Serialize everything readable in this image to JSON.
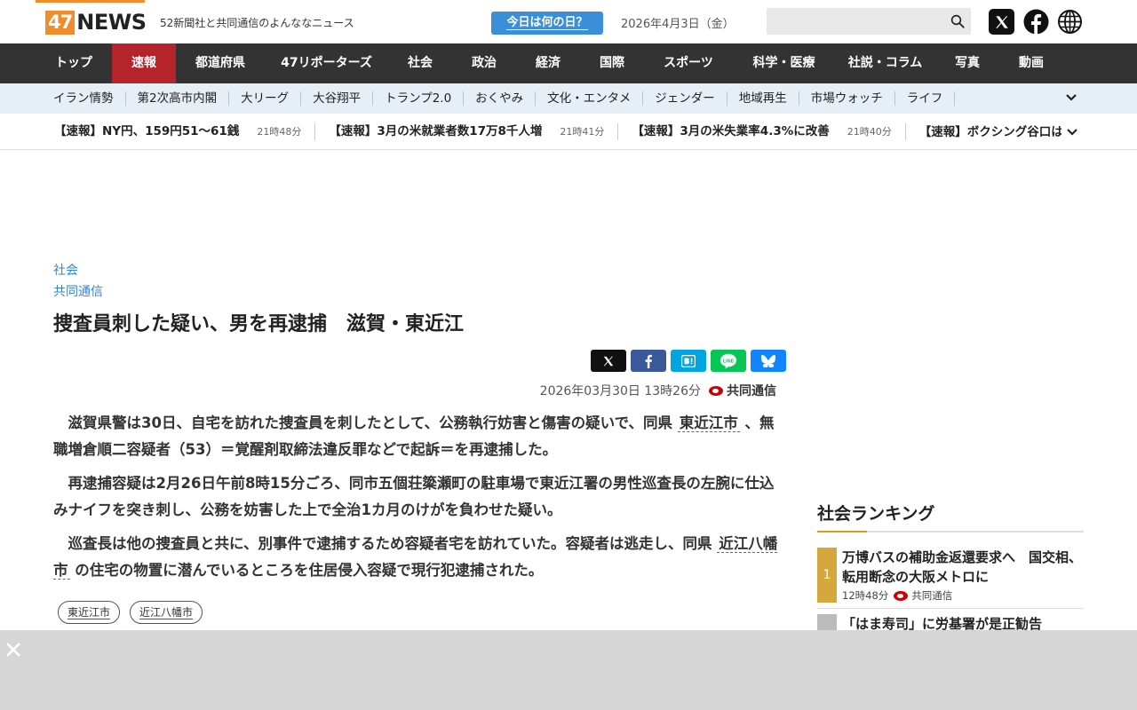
{
  "header": {
    "logo_number": "47",
    "logo_word": "NEWS",
    "tagline": "52新聞社と共同通信のよんななニュース",
    "today_button": "今日は何の日？",
    "date": "2026年4月3日（金）",
    "search_placeholder": "",
    "icons": [
      "search-icon",
      "x-icon",
      "facebook-icon",
      "globe-icon"
    ]
  },
  "mainnav": {
    "items": [
      "トップ",
      "速報",
      "都道府県",
      "47リポーターズ",
      "社会",
      "政治",
      "経済",
      "国際",
      "スポーツ",
      "科学・医療",
      "社説・コラム",
      "写真",
      "動画"
    ],
    "active": "速報"
  },
  "subnav": {
    "items": [
      "イラン情勢",
      "第2次高市内閣",
      "大リーグ",
      "大谷翔平",
      "トランプ2.0",
      "おくやみ",
      "文化・エンタメ",
      "ジェンダー",
      "地域再生",
      "市場ウォッチ",
      "ライフ"
    ]
  },
  "ticker": {
    "items": [
      {
        "text": "【速報】NY円、159円51～61銭",
        "time": "21時48分"
      },
      {
        "text": "【速報】3月の米就業者数17万8千人増",
        "time": "21時41分"
      },
      {
        "text": "【速報】3月の米失業率4.3%に改善",
        "time": "21時40分"
      },
      {
        "text": "【速報】ボクシング谷口は判",
        "time": ""
      }
    ]
  },
  "article": {
    "category": "社会",
    "source": "共同通信",
    "title": "捜査員刺した疑い、男を再逮捕　滋賀・東近江",
    "datetime": "2026年03月30日  13時26分",
    "publisher": "共同通信",
    "p1_a": "滋賀県警は30日、自宅を訪れた捜査員を刺したとして、公務執行妨害と傷害の疑いで、同県",
    "p1_link": "東近江市",
    "p1_b": "、無職増倉順二容疑者（53）＝覚醒剤取締法違反罪などで起訴＝を再逮捕した。",
    "p2": "再逮捕容疑は2月26日午前8時15分ごろ、同市五個荘簗瀬町の駐車場で東近江署の男性巡査長の左腕に仕込みナイフを突き刺し、公務を妨害した上で全治1カ月のけがを負わせた疑い。",
    "p3_a": "巡査長は他の捜査員と共に、別事件で逮捕するため容疑者宅を訪れていた。容疑者は逃走し、同県",
    "p3_link": "近江八幡市",
    "p3_b": "の住宅の物置に潜んでいるところを住居侵入容疑で現行犯逮捕された。",
    "tags": [
      "東近江市",
      "近江八幡市"
    ]
  },
  "ranking": {
    "title": "社会ランキング",
    "items": [
      {
        "rank": "1",
        "text": "万博バスの補助金返還要求へ　国交相、転用断念の大阪メトロに",
        "time": "12時48分",
        "source": "共同通信"
      },
      {
        "rank": "",
        "text": "「はま寿司」に労基署が是正勧告",
        "time": "",
        "source": ""
      }
    ]
  },
  "colors": {
    "brand_orange": "#f08c2a",
    "nav_bg": "#333333",
    "nav_active": "#b5232b",
    "link_blue": "#2d87d0",
    "rank_gold": "#d4a83a"
  }
}
